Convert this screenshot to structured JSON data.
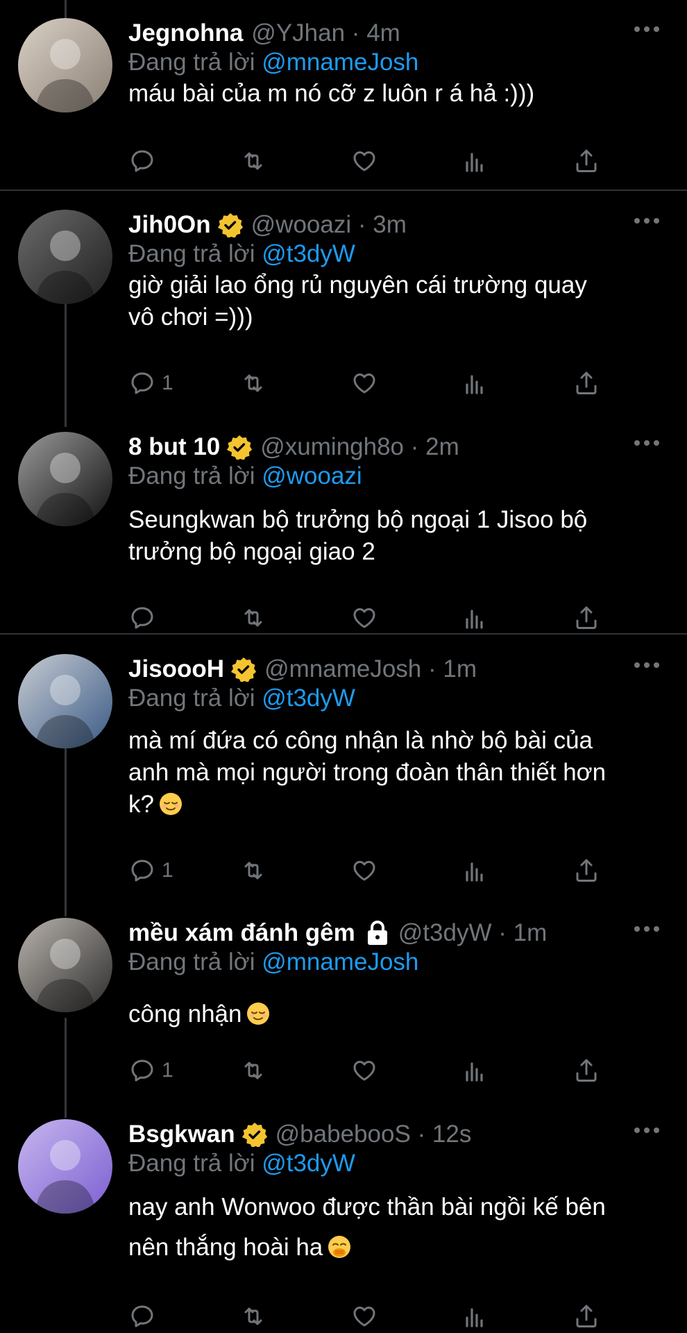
{
  "tweets": [
    {
      "display_name": "Jegnohna",
      "handle": "@YJhan",
      "time": "4m",
      "verified": false,
      "locked": false,
      "reply_prefix": "Đang trả lời",
      "reply_to": "@mnameJosh",
      "lines": [
        "máu bài của m nó cỡ z luôn r á hả :)))"
      ],
      "emoji": "",
      "reply_count": "",
      "avatar_colors": [
        "#d9d0c5",
        "#8a7f74"
      ]
    },
    {
      "display_name": "Jih0On",
      "handle": "@wooazi",
      "time": "3m",
      "verified": true,
      "locked": false,
      "reply_prefix": "Đang trả lời",
      "reply_to": "@t3dyW",
      "lines": [
        "giờ giải lao ổng rủ nguyên cái trường quay",
        "vô chơi =)))"
      ],
      "emoji": "",
      "reply_count": "1",
      "avatar_colors": [
        "#6b6b6b",
        "#1f1f1f"
      ]
    },
    {
      "display_name": "8 but 10",
      "handle": "@xumingh8o",
      "time": "2m",
      "verified": true,
      "locked": false,
      "reply_prefix": "Đang trả lời",
      "reply_to": "@wooazi",
      "lines": [
        "Seungkwan bộ trưởng bộ ngoại 1 Jisoo bộ",
        "trưởng bộ ngoại giao 2"
      ],
      "emoji": "",
      "reply_count": "",
      "avatar_colors": [
        "#9a9a9a",
        "#111111"
      ]
    },
    {
      "display_name": "JisoooH",
      "handle": "@mnameJosh",
      "time": "1m",
      "verified": true,
      "locked": false,
      "reply_prefix": "Đang trả lời",
      "reply_to": "@t3dyW",
      "lines": [
        "mà mí đứa có công nhận là nhờ bộ bài của",
        "anh mà mọi người trong đoàn thân thiết hơn",
        "k?"
      ],
      "emoji": "relieved-face",
      "reply_count": "1",
      "avatar_colors": [
        "#c8ccd2",
        "#3a5a86"
      ]
    },
    {
      "display_name": "mều xám đánh gêm",
      "handle": "@t3dyW",
      "time": "1m",
      "verified": false,
      "locked": true,
      "reply_prefix": "Đang trả lời",
      "reply_to": "@mnameJosh",
      "lines": [
        "công nhận"
      ],
      "emoji": "relieved-face",
      "reply_count": "1",
      "avatar_colors": [
        "#b9b3ad",
        "#2c2c2c"
      ]
    },
    {
      "display_name": "Bsgkwan",
      "handle": "@babebooS",
      "time": "12s",
      "verified": true,
      "locked": false,
      "reply_prefix": "Đang trả lời",
      "reply_to": "@t3dyW",
      "lines": [
        "nay anh Wonwoo được thần bài ngồi kế bên",
        "nên thắng hoài ha"
      ],
      "emoji": "hand-over-mouth-face",
      "reply_count": "",
      "avatar_colors": [
        "#c7b6ef",
        "#7b5fd1"
      ]
    }
  ],
  "colors": {
    "background": "#000000",
    "text": "#ffffff",
    "secondary": "#71767b",
    "link": "#1d9bf0",
    "verified": "#f4c430",
    "separator": "#2f3336"
  },
  "action_icons": [
    "reply-icon",
    "retweet-icon",
    "like-icon",
    "views-icon",
    "share-icon"
  ]
}
